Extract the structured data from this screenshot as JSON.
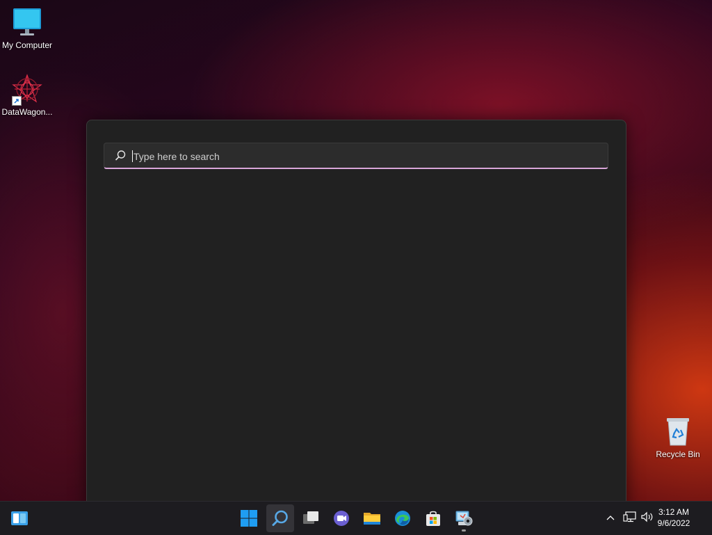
{
  "desktop": {
    "icons": [
      {
        "label": "My Computer",
        "icon": "monitor-icon"
      },
      {
        "label": "DataWagon...",
        "icon": "datawagon-app-icon"
      },
      {
        "label": "Recycle Bin",
        "icon": "recycle-bin-icon"
      }
    ]
  },
  "search": {
    "placeholder": "Type here to search",
    "value": ""
  },
  "taskbar": {
    "widgets_icon": "widgets-icon",
    "pinned": [
      {
        "name": "Start",
        "icon": "windows-logo-icon"
      },
      {
        "name": "Search",
        "icon": "search-icon",
        "active": true
      },
      {
        "name": "Task View",
        "icon": "task-view-icon"
      },
      {
        "name": "Chat",
        "icon": "teams-chat-icon"
      },
      {
        "name": "File Explorer",
        "icon": "folder-icon"
      },
      {
        "name": "Microsoft Edge",
        "icon": "edge-icon"
      },
      {
        "name": "Microsoft Store",
        "icon": "store-icon"
      },
      {
        "name": "Control Panel",
        "icon": "control-panel-icon",
        "running": true
      }
    ],
    "tray": {
      "icons": [
        "chevron-up-icon",
        "network-icon",
        "volume-icon"
      ],
      "time": "3:12 AM",
      "date": "9/6/2022"
    }
  },
  "colors": {
    "flyout_bg": "#212121",
    "search_accent": "#d9a6d9",
    "taskbar_bg": "#1d1c20"
  }
}
